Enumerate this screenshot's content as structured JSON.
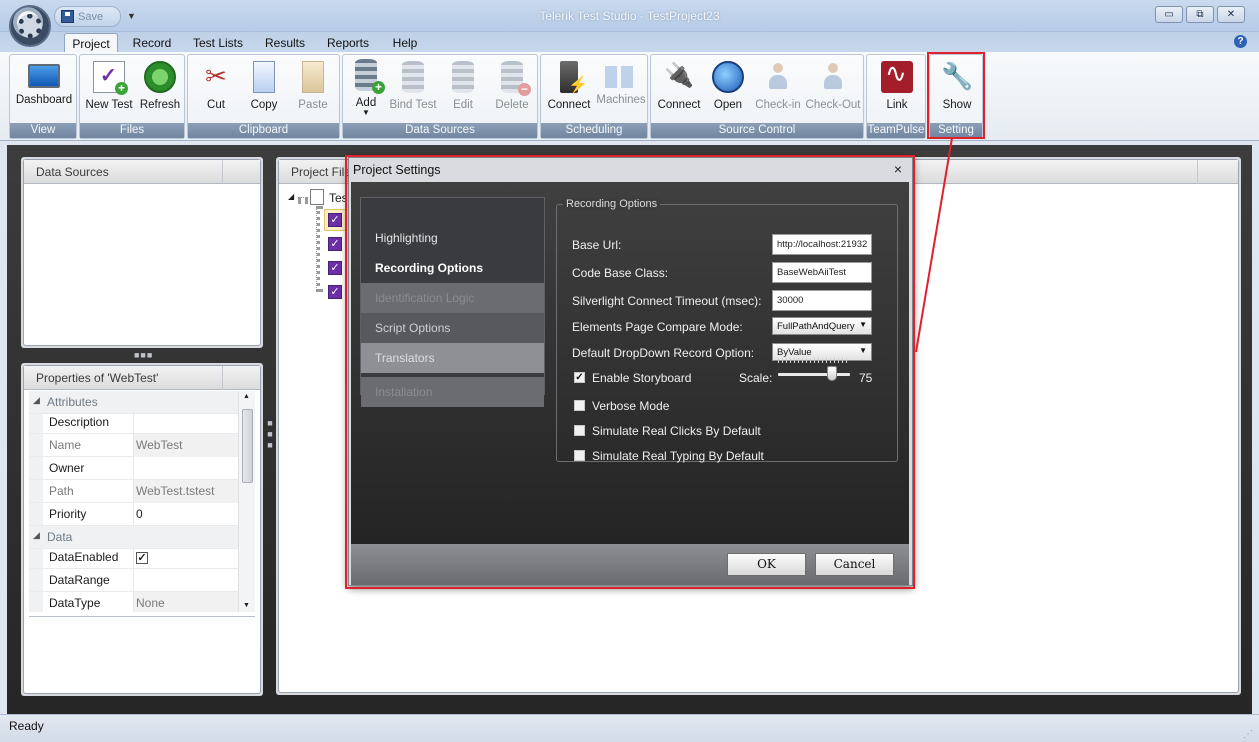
{
  "window": {
    "title": "Telerik Test Studio - TestProject23",
    "quick_access": {
      "save_label": "Save"
    },
    "controls": {
      "minimize": "▭",
      "restore": "⧉",
      "close": "✕"
    }
  },
  "ribbon_tabs": [
    "Project",
    "Record",
    "Test Lists",
    "Results",
    "Reports",
    "Help"
  ],
  "ribbon_active_tab": "Project",
  "ribbon_groups": {
    "view": {
      "label": "View",
      "buttons": [
        "Dashboard"
      ]
    },
    "files": {
      "label": "Files",
      "buttons": [
        "New Test",
        "Refresh"
      ]
    },
    "clipboard": {
      "label": "Clipboard",
      "buttons": [
        "Cut",
        "Copy",
        "Paste"
      ]
    },
    "data_sources": {
      "label": "Data Sources",
      "buttons": [
        "Add",
        "Bind Test",
        "Edit",
        "Delete"
      ]
    },
    "scheduling": {
      "label": "Scheduling",
      "buttons": [
        "Connect",
        "Machines"
      ]
    },
    "source_control": {
      "label": "Source Control",
      "buttons": [
        "Connect",
        "Open",
        "Check-in",
        "Check-Out"
      ]
    },
    "teampulse": {
      "label": "TeamPulse",
      "buttons": [
        "Link"
      ]
    },
    "setting": {
      "label": "Setting",
      "buttons": [
        "Show"
      ]
    }
  },
  "panels": {
    "data_sources_title": "Data Sources",
    "properties_title": "Properties of 'WebTest'",
    "project_files_title": "Project Files",
    "tree_root_label": "Tes"
  },
  "properties": {
    "attributes_label": "Attributes",
    "data_label": "Data",
    "rows": [
      {
        "key": "Description",
        "value": ""
      },
      {
        "key": "Name",
        "value": "WebTest"
      },
      {
        "key": "Owner",
        "value": ""
      },
      {
        "key": "Path",
        "value": "WebTest.tstest"
      },
      {
        "key": "Priority",
        "value": "0"
      }
    ],
    "data_rows": [
      {
        "key": "DataEnabled",
        "value": "✓"
      },
      {
        "key": "DataRange",
        "value": ""
      },
      {
        "key": "DataType",
        "value": "None"
      }
    ]
  },
  "dialog": {
    "title": "Project Settings",
    "close": "×",
    "nav": [
      "Highlighting",
      "Recording Options",
      "Identification Logic",
      "Script Options",
      "Translators",
      "Installation"
    ],
    "selected_nav": "Recording Options",
    "group_title": "Recording Options",
    "fields": {
      "base_url_label": "Base Url:",
      "base_url_value": "http://localhost:21932",
      "code_base_class_label": "Code Base Class:",
      "code_base_class_value": "BaseWebAiiTest",
      "timeout_label": "Silverlight Connect Timeout (msec):",
      "timeout_value": "30000",
      "compare_mode_label": "Elements Page Compare Mode:",
      "compare_mode_value": "FullPathAndQuery",
      "dropdown_option_label": "Default DropDown Record Option:",
      "dropdown_option_value": "ByValue"
    },
    "checks": {
      "enable_storyboard": {
        "label": "Enable Storyboard",
        "checked": true
      },
      "verbose_mode": {
        "label": "Verbose Mode",
        "checked": false
      },
      "real_clicks": {
        "label": "Simulate Real Clicks By Default",
        "checked": false
      },
      "real_typing": {
        "label": "Simulate Real Typing By Default",
        "checked": false
      }
    },
    "scale": {
      "label": "Scale:",
      "value": 75,
      "min": 0,
      "max": 100
    },
    "ok_label": "OK",
    "cancel_label": "Cancel"
  },
  "status": {
    "text": "Ready"
  },
  "colors": {
    "highlight": "#e0202a",
    "accent": "#6a2fa5"
  }
}
